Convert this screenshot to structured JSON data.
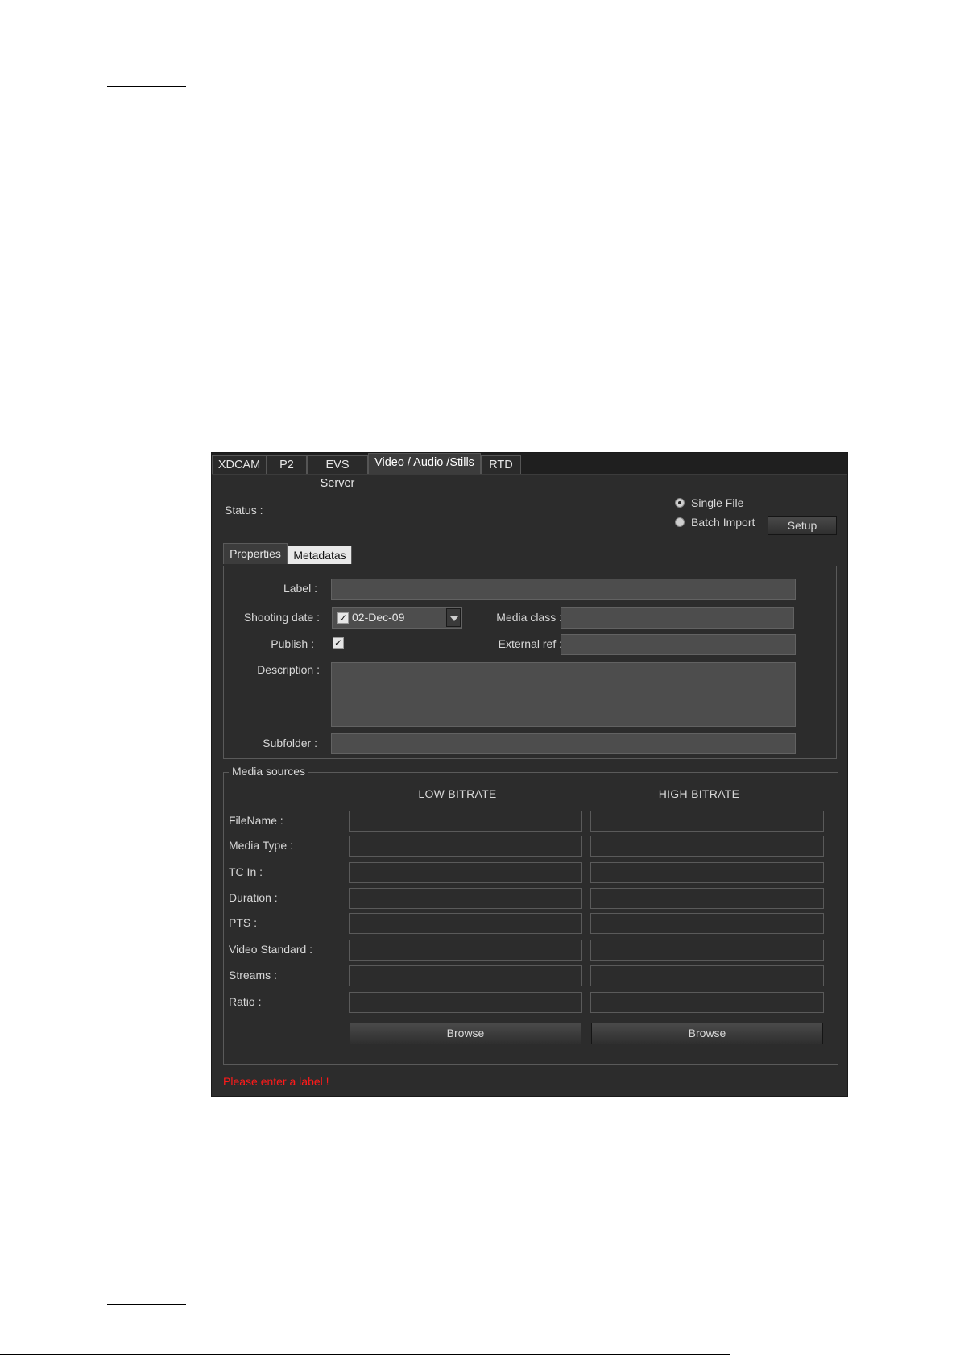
{
  "tabs": [
    "XDCAM",
    "P2",
    "EVS Server",
    "Video / Audio /Stills",
    "RTD"
  ],
  "status_label": "Status :",
  "import_mode": {
    "options": [
      "Single File",
      "Batch Import"
    ],
    "selected": "Single File"
  },
  "setup_button": "Setup",
  "subtabs": [
    "Properties",
    "Metadatas"
  ],
  "properties": {
    "label_label": "Label :",
    "label_value": "",
    "shooting_date_label": "Shooting date :",
    "shooting_date_checked": true,
    "shooting_date_value": "02-Dec-09",
    "media_class_label": "Media class :",
    "media_class_value": "",
    "publish_label": "Publish :",
    "publish_checked": true,
    "external_ref_label": "External ref :",
    "external_ref_value": "",
    "description_label": "Description :",
    "description_value": "",
    "subfolder_label": "Subfolder :",
    "subfolder_value": ""
  },
  "media_sources": {
    "legend": "Media sources",
    "col_low": "LOW BITRATE",
    "col_high": "HIGH BITRATE",
    "rows": [
      "FileName :",
      "Media Type :",
      "TC In :",
      "Duration :",
      "PTS :",
      "Video Standard :",
      "Streams :",
      "Ratio :"
    ],
    "browse_label": "Browse"
  },
  "error_message": "Please enter a label !",
  "colors": {
    "background": "#2c2c2c",
    "field": "#4d4d4d",
    "error": "#ff1a1a"
  }
}
